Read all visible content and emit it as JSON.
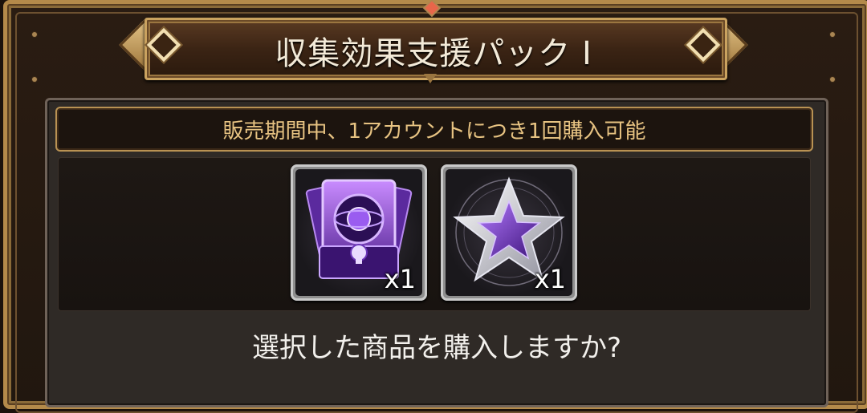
{
  "dialog": {
    "title": "収集効果支援パック I",
    "notice": "販売期間中、1アカウントにつき1回購入可能",
    "items": [
      {
        "icon": "purple-card-chest-icon",
        "quantity": "x1"
      },
      {
        "icon": "silver-purple-star-icon",
        "quantity": "x1"
      }
    ],
    "confirm_question": "選択した商品を購入しますか?"
  },
  "colors": {
    "frame_gold": "#b48a4a",
    "notice_text": "#e7c382",
    "title_text": "#f3ead8",
    "accent_purple": "#7b3fd1"
  }
}
